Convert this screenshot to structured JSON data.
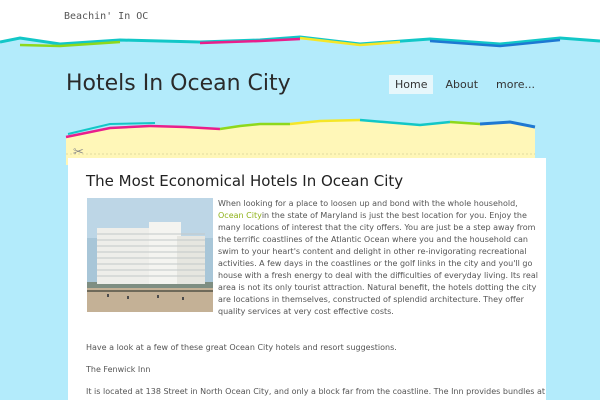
{
  "header": {
    "tagline": "Beachin' In OC",
    "site_title": "Hotels In Ocean City"
  },
  "nav": {
    "items": [
      {
        "label": "Home",
        "active": true
      },
      {
        "label": "About",
        "active": false
      },
      {
        "label": "more...",
        "active": false
      }
    ]
  },
  "post": {
    "title": "The Most Economical Hotels In Ocean City",
    "intro_before": "When looking for a place to loosen up and bond with the whole household, ",
    "intro_link": "Ocean City",
    "intro_after": "in the state of Maryland is just the best location for you. Enjoy the many locations of interest that the city offers. You are just be a step away from the terrific coastlines of the Atlantic Ocean where you and the household can swim to your heart's content and delight in other re-invigorating recreational activities. A few days in the coastlines or the golf links in the city and you'll go house with a fresh energy to deal with the difficulties of everyday living. Its real area is not its only tourist attraction. Natural benefit, the hotels dotting the city are locations in themselves, constructed of splendid architecture. They offer quality services at very cost effective costs.",
    "para2": "Have a look at a few of these great Ocean City hotels and resort suggestions.",
    "para3": "The Fenwick Inn",
    "para4": "It is located at 138 Street in North Ocean City, and only a block far from the coastline. The Inn provides bundles at less"
  },
  "colors": {
    "sky": "#b3ebfb",
    "sand": "#fff7b8",
    "link": "#8fb21a",
    "accent_stripes": [
      "#e91e8c",
      "#12c7c7",
      "#8ed81c",
      "#f5e628",
      "#1e78d2"
    ]
  }
}
